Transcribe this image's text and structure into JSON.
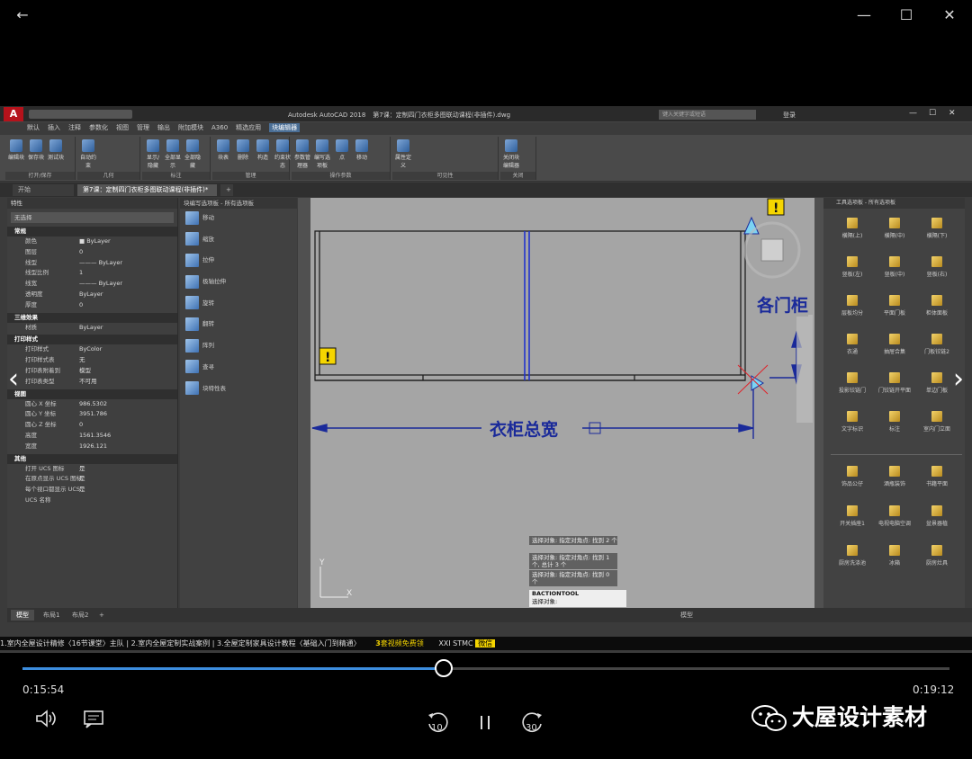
{
  "window": {
    "back": "←",
    "minimize": "—",
    "maximize": "☐",
    "close": "✕"
  },
  "autocad": {
    "app_title": "Autodesk AutoCAD 2018",
    "doc_title": "第7课：定制四门衣柜多图联动课程(非插件).dwg",
    "search_placeholder": "键入关键字或短语",
    "login": "登录",
    "menu": [
      "默认",
      "插入",
      "注释",
      "参数化",
      "视图",
      "管理",
      "输出",
      "附加模块",
      "A360",
      "精选应用",
      "块编辑器"
    ],
    "menu_active_index": 10,
    "ribbon": {
      "groups": [
        {
          "label": "打开/保存",
          "tools": [
            "编辑块",
            "保存块",
            "测试块"
          ]
        },
        {
          "label": "几何",
          "tools": [
            "自动约束"
          ]
        },
        {
          "label": "标注",
          "tools": [
            "显示/隐藏",
            "全部显示",
            "全部隐藏"
          ]
        },
        {
          "label": "管理",
          "tools": [
            "块表",
            "删除",
            "构造",
            "约束状态"
          ]
        },
        {
          "label": "操作参数",
          "tools": [
            "参数管理器",
            "编写选项板",
            "点",
            "移动"
          ]
        },
        {
          "label": "可见性",
          "tools": [
            "属性定义"
          ]
        },
        {
          "label": "关闭",
          "tools": [
            "关闭块编辑器"
          ]
        }
      ]
    },
    "tabs": [
      "开始",
      "第7课：定制四门衣柜多图联动课程(非插件)*"
    ],
    "properties": {
      "title": "特性",
      "selection": "无选择",
      "sections": [
        {
          "name": "常规",
          "rows": [
            [
              "颜色",
              "■ ByLayer"
            ],
            [
              "图层",
              "0"
            ],
            [
              "线型",
              "——— ByLayer"
            ],
            [
              "线型比例",
              "1"
            ],
            [
              "线宽",
              "——— ByLayer"
            ],
            [
              "透明度",
              "ByLayer"
            ],
            [
              "厚度",
              "0"
            ]
          ]
        },
        {
          "name": "三维效果",
          "rows": [
            [
              "材质",
              "ByLayer"
            ]
          ]
        },
        {
          "name": "打印样式",
          "rows": [
            [
              "打印样式",
              "ByColor"
            ],
            [
              "打印样式表",
              "无"
            ],
            [
              "打印表附着到",
              "模型"
            ],
            [
              "打印表类型",
              "不可用"
            ]
          ]
        },
        {
          "name": "视图",
          "rows": [
            [
              "圆心 X 坐标",
              "986.5302"
            ],
            [
              "圆心 Y 坐标",
              "3951.786"
            ],
            [
              "圆心 Z 坐标",
              "0"
            ],
            [
              "高度",
              "1561.3546"
            ],
            [
              "宽度",
              "1926.121"
            ]
          ]
        },
        {
          "name": "其他",
          "rows": [
            [
              "打开 UCS 图标",
              "是"
            ],
            [
              "在原点显示 UCS 图标",
              "是"
            ],
            [
              "每个视口都显示 UCS",
              "是"
            ],
            [
              "UCS 名称",
              ""
            ]
          ]
        }
      ]
    },
    "block_palette": {
      "title": "块编写选项板 - 所有选项板",
      "items": [
        "移动",
        "缩放",
        "拉伸",
        "极轴拉伸",
        "旋转",
        "翻转",
        "阵列",
        "查寻",
        "块特性表"
      ]
    },
    "tool_palette": {
      "title": "工具选项板 - 所有选项板",
      "items": [
        "横隔(上)",
        "横隔(中)",
        "横隔(下)",
        "竖板(左)",
        "竖板(中)",
        "竖板(右)",
        "层板均分",
        "平面门板",
        "柜体面板",
        "衣通",
        "抽屉合集",
        "门板铰链2",
        "投影铰链门",
        "门铰链开平面",
        "单边门板",
        "文字标识",
        "标注",
        "室内门立面",
        "饰品公仔",
        "酒瓶装饰",
        "书籍平面",
        "开关插座1",
        "电视电脑空调",
        "盆景器植",
        "厨房洗涤池",
        "冰箱",
        "厨房灶具"
      ]
    },
    "drawing": {
      "dim_width": "衣柜总宽",
      "dim_height": "各门柜"
    },
    "command_history": [
      "选择对象: 指定对角点: 找到 2 个",
      "选择对象: 指定对角点: 找到 1 个, 总计 3 个",
      "选择对象: 指定对角点: 找到 0 个"
    ],
    "command_name": "BACTIONTOOL",
    "command_prompt": "选择对象:",
    "layout_tabs": [
      "模型",
      "布局1",
      "布局2",
      "+"
    ],
    "status_model": "模型",
    "course_bar": {
      "text": "1.室内全屋设计精修〈16节课堂〉主队 | 2.室内全屋定制实战案例 | 3.全屋定制家具设计教程〈基础入门到精通〉",
      "badge": "3",
      "badge_text": "套视频免费领",
      "contact": "XXI STMC",
      "wechat": "微信"
    }
  },
  "player": {
    "current_time": "0:15:54",
    "total_time": "0:19:12",
    "progress_fraction": 0.454,
    "volume_icon": "volume-icon",
    "subtitles_icon": "subtitles-icon",
    "rewind_label": "10",
    "forward_label": "30",
    "pause_icon": "pause-icon"
  },
  "watermark": "大屋设计素材",
  "colors": {
    "accent": "#3c8dde",
    "dimension_blue": "#1a2a9a",
    "warning_yellow": "#f5d500"
  }
}
